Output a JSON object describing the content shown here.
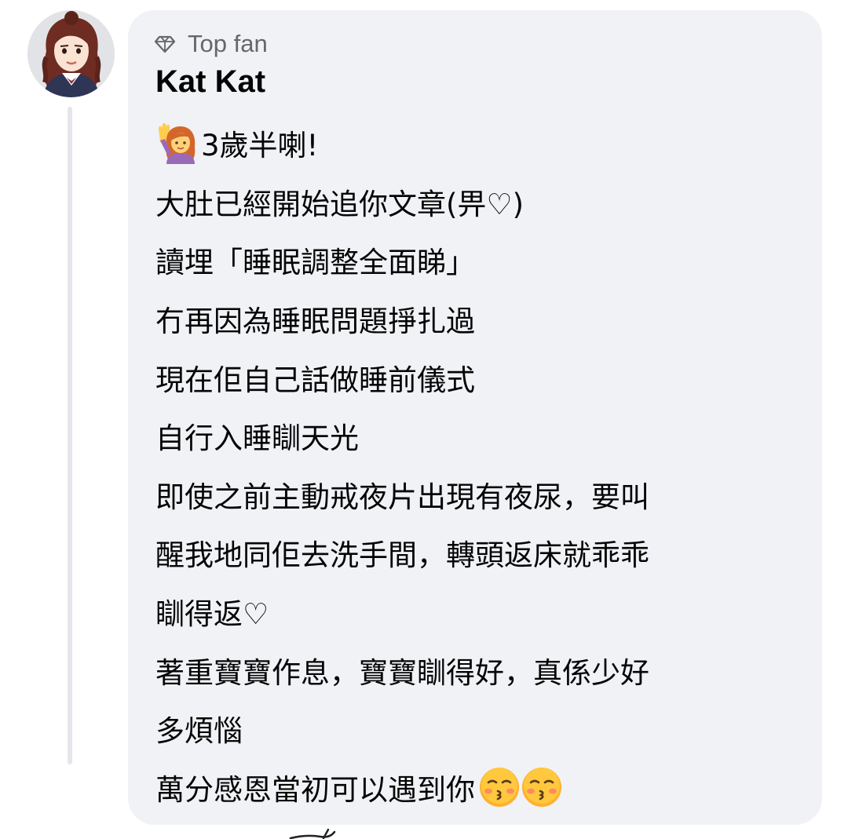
{
  "comment": {
    "badge": "Top fan",
    "author": "Kat Kat",
    "lines": [
      "3歲半喇!",
      "大肚已經開始追你文章(畀♡)",
      "讀埋「睡眠調整全面睇」",
      "冇再因為睡眠問題掙扎過",
      "現在佢自己話做睡前儀式",
      "自行入睡瞓天光",
      "即使之前主動戒夜片出現有夜尿，要叫",
      "醒我地同佢去洗手間，轉頭返床就乖乖",
      "瞓得返♡",
      "著重寶寶作息，寶寶瞓得好，真係少好",
      "多煩惱",
      "萬分感恩當初可以遇到你"
    ],
    "lead_emoji": "woman-raising-hand-emoji",
    "trail_emojis": [
      "kissing-face-emoji",
      "kissing-face-emoji"
    ],
    "badge_icon": "diamond-icon",
    "colors": {
      "bubble": "#f0f2f5",
      "text": "#050505",
      "badge_text": "#65676b",
      "thread_line": "#e4e6eb"
    }
  }
}
